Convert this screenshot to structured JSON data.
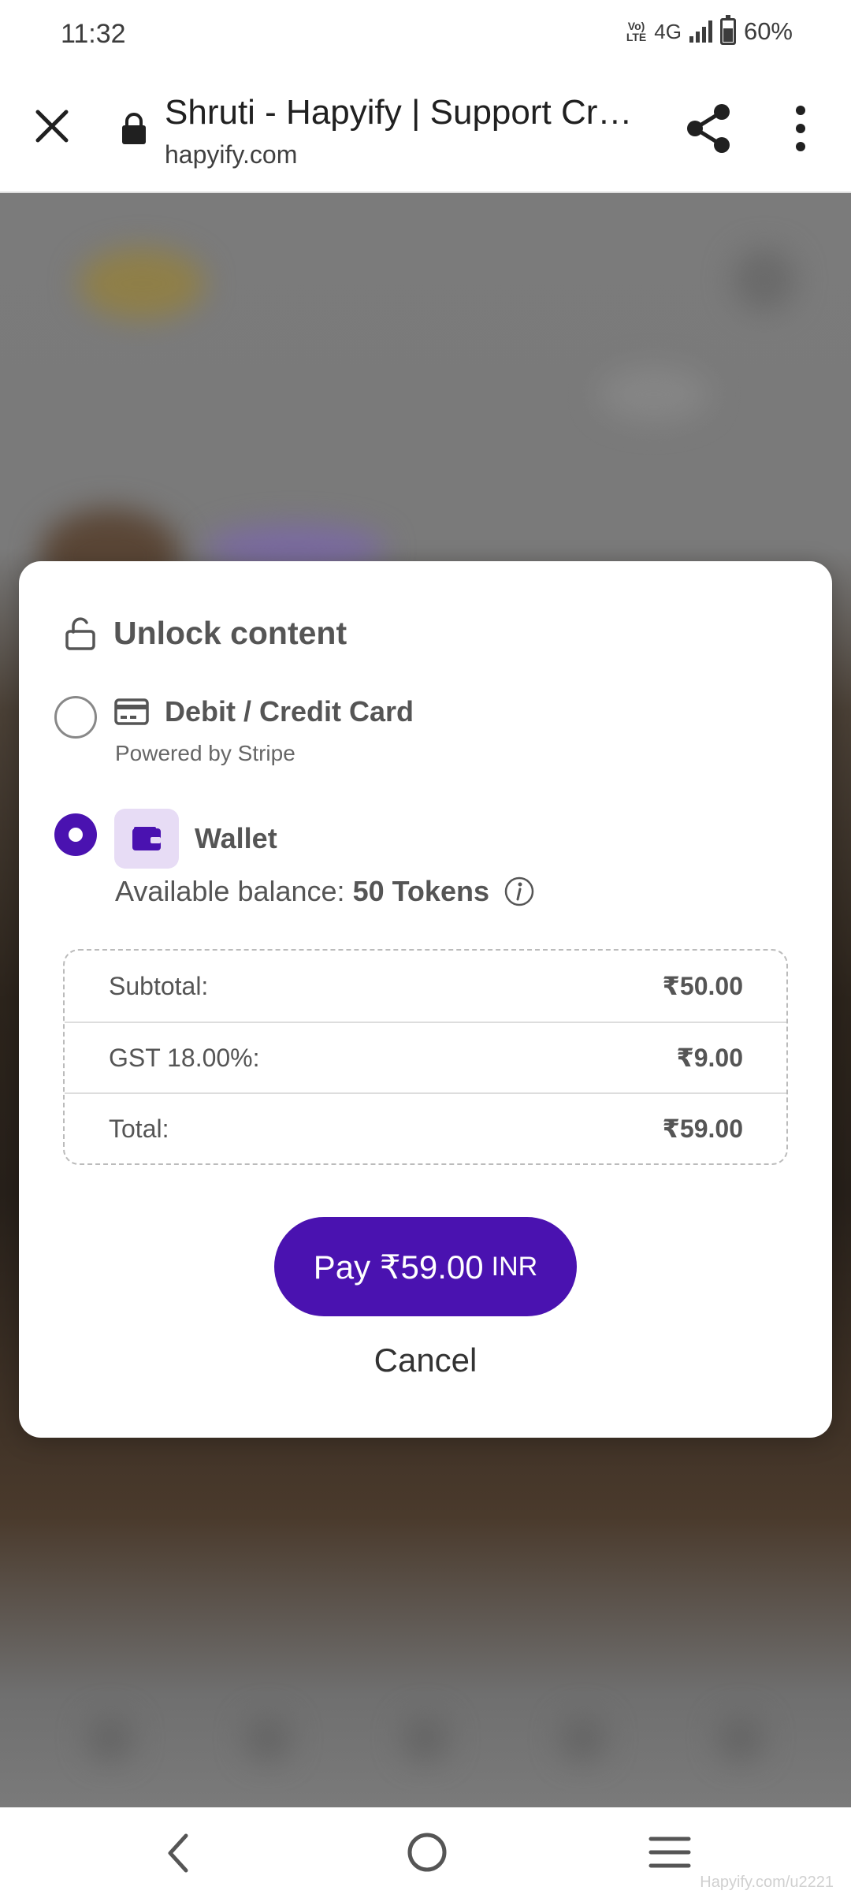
{
  "status_bar": {
    "time": "11:32",
    "volte": "VoLTE",
    "network": "4G",
    "battery": "60%"
  },
  "browser": {
    "title": "Shruti - Hapyify | Support Cre...",
    "url": "hapyify.com",
    "icons": [
      "close-icon",
      "lock-icon",
      "share-icon",
      "more-vert-icon"
    ]
  },
  "modal": {
    "title": "Unlock content",
    "payment_options": [
      {
        "label": "Debit / Credit Card",
        "sublabel": "Powered by Stripe",
        "selected": false,
        "icon": "credit-card-icon"
      },
      {
        "label": "Wallet",
        "selected": true,
        "icon": "wallet-icon"
      }
    ],
    "balance": {
      "label": "Available balance:",
      "value": "50 Tokens"
    },
    "summary": [
      {
        "label": "Subtotal:",
        "amount": "₹50.00"
      },
      {
        "label": "GST 18.00%:",
        "amount": "₹9.00"
      },
      {
        "label": "Total:",
        "amount": "₹59.00"
      }
    ],
    "pay_button": {
      "label": "Pay ₹59.00",
      "currency": "INR"
    },
    "cancel_label": "Cancel"
  },
  "colors": {
    "accent": "#4a12b0",
    "wallet_icon_bg": "#e7dcf5"
  },
  "watermark": "Hapyify.com/u2221"
}
